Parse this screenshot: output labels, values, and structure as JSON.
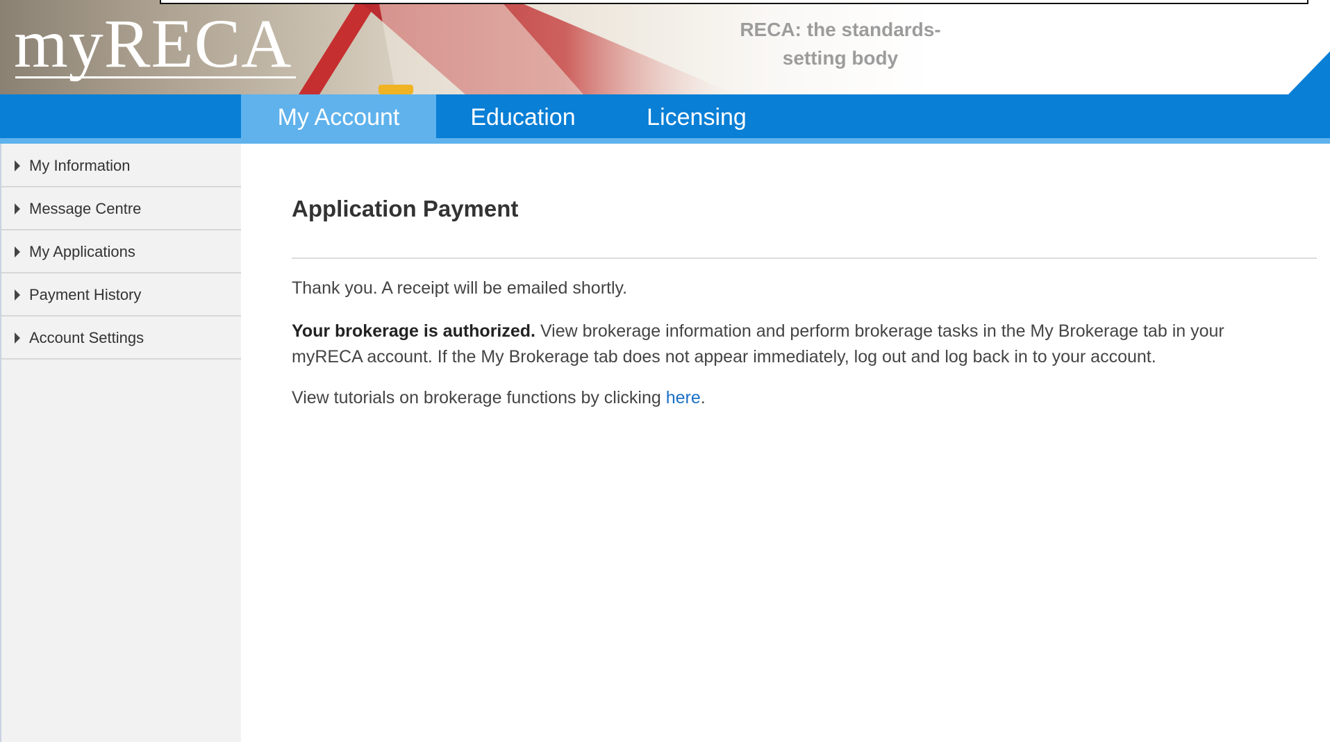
{
  "header": {
    "logo_text": "myRECA",
    "tagline_line1": "RECA: the standards-",
    "tagline_line2": "setting body"
  },
  "nav": {
    "tabs": [
      {
        "label": "My Account",
        "active": true
      },
      {
        "label": "Education",
        "active": false
      },
      {
        "label": "Licensing",
        "active": false
      }
    ]
  },
  "sidebar": {
    "items": [
      {
        "label": "My Information"
      },
      {
        "label": "Message Centre"
      },
      {
        "label": "My Applications"
      },
      {
        "label": "Payment History"
      },
      {
        "label": "Account Settings"
      }
    ]
  },
  "main": {
    "title": "Application Payment",
    "thanks_text": "Thank you. A receipt will be emailed shortly.",
    "authorized_bold": "Your brokerage is authorized.",
    "authorized_text": " View brokerage information and perform brokerage tasks in the My Brokerage tab in your myRECA account. If the My Brokerage tab does not appear immediately, log out and log back in to your account.",
    "tutorials_text": "View tutorials on brokerage functions by clicking ",
    "tutorials_link": "here",
    "tutorials_end": "."
  },
  "colors": {
    "nav_blue": "#0a7fd6",
    "active_tab": "#5fb2ec",
    "link": "#1b6fc7",
    "roof_red": "#b8282c"
  },
  "icons": {
    "sidebar_bullet": "caret-right-icon"
  }
}
